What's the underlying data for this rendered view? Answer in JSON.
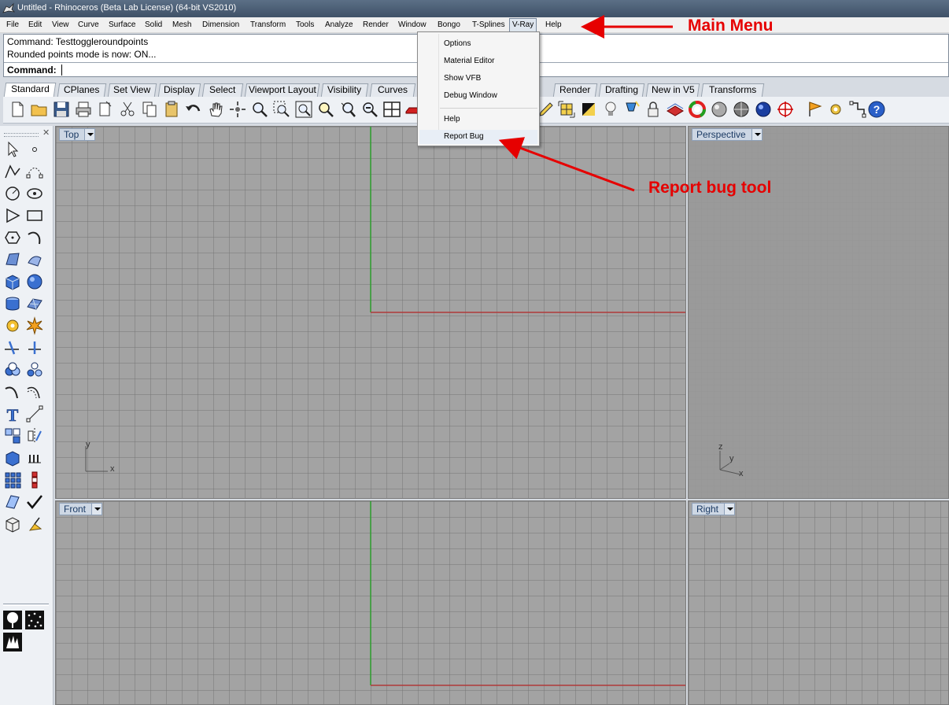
{
  "window": {
    "title": "Untitled - Rhinoceros (Beta Lab License) (64-bit VS2010)"
  },
  "menu": {
    "items": [
      "File",
      "Edit",
      "View",
      "Curve",
      "Surface",
      "Solid",
      "Mesh",
      "Dimension",
      "Transform",
      "Tools",
      "Analyze",
      "Render",
      "Window",
      "Bongo",
      "T-Splines",
      "V-Ray",
      "Help"
    ],
    "active": "V-Ray"
  },
  "command": {
    "history": [
      "Command: Testtoggleroundpoints",
      "Rounded points mode is now: ON..."
    ],
    "prompt": "Command:",
    "value": ""
  },
  "tabs": [
    "Standard",
    "CPlanes",
    "Set View",
    "Display",
    "Select",
    "Viewport Layout",
    "Visibility",
    "Curves",
    "Render",
    "Drafting",
    "New in V5",
    "Transforms"
  ],
  "tabs_active": "Standard",
  "vray_menu": {
    "items": [
      "Options",
      "Material Editor",
      "Show VFB",
      "Debug Window",
      "Help",
      "Report Bug"
    ]
  },
  "viewports": {
    "top": "Top",
    "perspective": "Perspective",
    "front": "Front",
    "right": "Right"
  },
  "axes": {
    "top": {
      "x": "x",
      "y": "y"
    },
    "perspective": {
      "x": "x",
      "y": "y",
      "z": "z"
    }
  },
  "annotations": {
    "main_menu": "Main Menu",
    "report_bug": "Report bug tool"
  },
  "colors": {
    "annotation": "#e60000",
    "x_axis": "#b03a3a",
    "y_axis": "#2ea02e"
  }
}
